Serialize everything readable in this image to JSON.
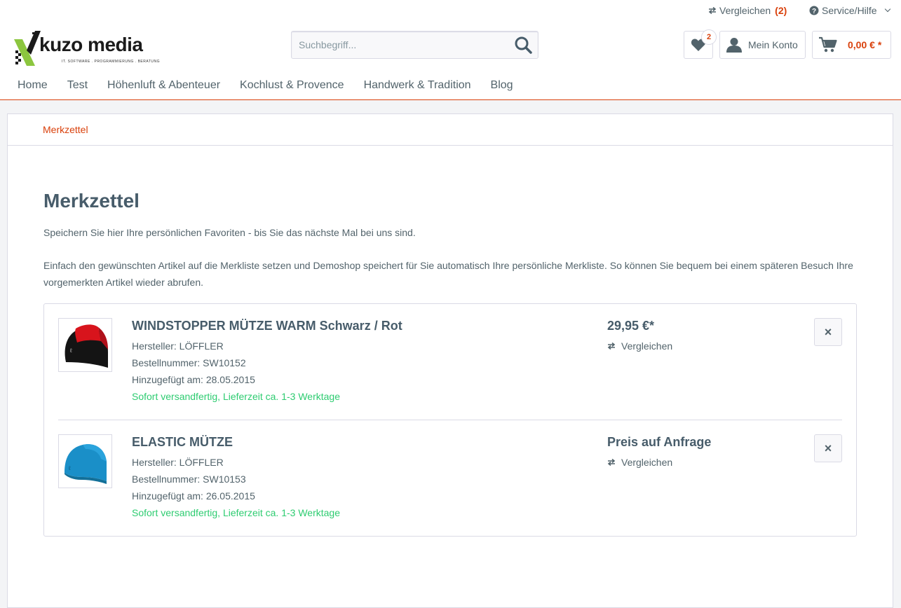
{
  "top_bar": {
    "compare_label": "Vergleichen",
    "compare_count": "(2)",
    "service_label": "Service/Hilfe"
  },
  "logo": {
    "text": "kuzo media",
    "tagline": "IT. SOFTWARE . PROGRAMMIERUNG . BERATUNG"
  },
  "search": {
    "placeholder": "Suchbegriff..."
  },
  "header_buttons": {
    "wishlist_count": "2",
    "account_label": "Mein Konto",
    "cart_amount": "0,00 € *"
  },
  "nav": {
    "items": [
      "Home",
      "Test",
      "Höhenluft & Abenteuer",
      "Kochlust & Provence",
      "Handwerk & Tradition",
      "Blog"
    ]
  },
  "breadcrumb": {
    "current": "Merkzettel"
  },
  "page": {
    "title": "Merkzettel",
    "intro1": "Speichern Sie hier Ihre persönlichen Favoriten - bis Sie das nächste Mal bei uns sind.",
    "intro2": "Einfach den gewünschten Artikel auf die Merkliste setzen und Demoshop speichert für Sie automatisch Ihre persönliche Merkliste. So können Sie bequem bei einem späteren Besuch Ihre vorgemerkten Artikel wieder abrufen."
  },
  "items": [
    {
      "name": "WINDSTOPPER MÜTZE WARM Schwarz / Rot",
      "manufacturer": "Hersteller: LÖFFLER",
      "order_number": "Bestellnummer: SW10152",
      "added": "Hinzugefügt am: 28.05.2015",
      "delivery": "Sofort versandfertig, Lieferzeit ca. 1-3 Werktage",
      "price": "29,95 €*",
      "compare_label": "Vergleichen",
      "remove_label": "×"
    },
    {
      "name": "ELASTIC MÜTZE",
      "manufacturer": "Hersteller: LÖFFLER",
      "order_number": "Bestellnummer: SW10153",
      "added": "Hinzugefügt am: 26.05.2015",
      "delivery": "Sofort versandfertig, Lieferzeit ca. 1-3 Werktage",
      "price": "Preis auf Anfrage",
      "compare_label": "Vergleichen",
      "remove_label": "×"
    }
  ],
  "colors": {
    "accent": "#d9400b",
    "text": "#52636b",
    "heading": "#475c6a",
    "delivery_green": "#2ecc71",
    "border": "#dadae5",
    "logo_green": "#8cc63f"
  }
}
